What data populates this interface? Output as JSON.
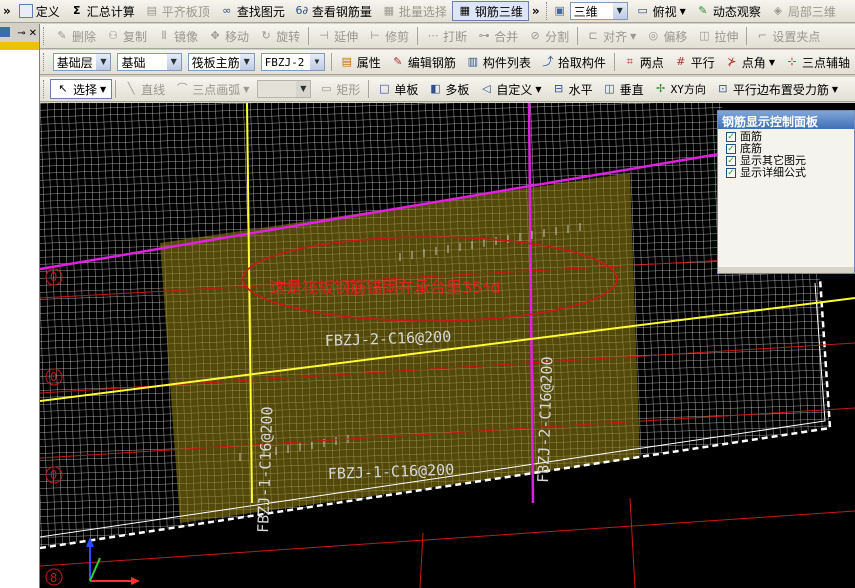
{
  "toolbar1": {
    "items": [
      {
        "label": "定义",
        "icon": "define-icon",
        "disabled": false
      },
      {
        "label": "汇总计算",
        "icon": "sigma-icon",
        "disabled": false
      },
      {
        "label": "平齐板顶",
        "icon": "level-icon",
        "disabled": true
      },
      {
        "label": "查找图元",
        "icon": "binoculars-icon",
        "disabled": false
      },
      {
        "label": "查看钢筋量",
        "icon": "rebar-icon",
        "disabled": false
      },
      {
        "label": "批量选择",
        "icon": "batch-select-icon",
        "disabled": true
      },
      {
        "label": "钢筋三维",
        "icon": "grid-3d-icon",
        "disabled": false,
        "active": true
      }
    ],
    "view_mode": "三维",
    "view_items": [
      {
        "label": "俯视",
        "icon": "top-view-icon",
        "disabled": false
      },
      {
        "label": "动态观察",
        "icon": "orbit-icon",
        "disabled": false
      },
      {
        "label": "局部三维",
        "icon": "local-3d-icon",
        "disabled": true
      }
    ]
  },
  "toolbar2": {
    "items": [
      {
        "label": "删除",
        "icon": "delete-icon"
      },
      {
        "label": "复制",
        "icon": "copy-icon"
      },
      {
        "label": "镜像",
        "icon": "mirror-icon"
      },
      {
        "label": "移动",
        "icon": "move-icon"
      },
      {
        "label": "旋转",
        "icon": "rotate-icon"
      },
      {
        "label": "延伸",
        "icon": "extend-icon"
      },
      {
        "label": "修剪",
        "icon": "trim-icon"
      },
      {
        "label": "打断",
        "icon": "break-icon"
      },
      {
        "label": "合并",
        "icon": "merge-icon"
      },
      {
        "label": "分割",
        "icon": "split-icon"
      },
      {
        "label": "对齐",
        "icon": "align-icon"
      },
      {
        "label": "偏移",
        "icon": "offset-icon"
      },
      {
        "label": "拉伸",
        "icon": "stretch-icon"
      },
      {
        "label": "设置夹点",
        "icon": "grip-point-icon"
      }
    ]
  },
  "toolbar3": {
    "floor": "基础层",
    "type": "基础",
    "component": "筏板主筋",
    "code": "FBZJ-2",
    "buttons": [
      {
        "label": "属性",
        "icon": "properties-icon"
      },
      {
        "label": "编辑钢筋",
        "icon": "edit-rebar-icon"
      },
      {
        "label": "构件列表",
        "icon": "list-icon"
      },
      {
        "label": "拾取构件",
        "icon": "pick-icon"
      },
      {
        "label": "两点",
        "icon": "two-point-icon"
      },
      {
        "label": "平行",
        "icon": "parallel-icon"
      },
      {
        "label": "点角",
        "icon": "point-angle-icon"
      },
      {
        "label": "三点辅轴",
        "icon": "three-point-axis-icon"
      }
    ]
  },
  "toolbar4": {
    "select_label": "选择",
    "disabled_items": [
      {
        "label": "直线",
        "icon": "line-icon"
      },
      {
        "label": "三点画弧",
        "icon": "arc-icon"
      },
      {
        "label": "矩形",
        "icon": "rect-icon"
      }
    ],
    "items": [
      {
        "label": "单板",
        "icon": "single-slab-icon"
      },
      {
        "label": "多板",
        "icon": "multi-slab-icon"
      },
      {
        "label": "自定义",
        "icon": "custom-icon"
      },
      {
        "label": "水平",
        "icon": "horizontal-icon"
      },
      {
        "label": "垂直",
        "icon": "vertical-icon"
      },
      {
        "label": "XY方向",
        "icon": "xy-direction-icon"
      },
      {
        "label": "平行边布置受力筋",
        "icon": "parallel-edge-icon"
      }
    ]
  },
  "left_panel": {
    "pin": "⊸",
    "close": "✕"
  },
  "viewport": {
    "annotation": "这是筏板钢筋锚固在承台里35*d",
    "labels": {
      "top_horizontal": "FBZJ-2-C16@200",
      "bottom_horizontal": "FBZJ-1-C16@200",
      "left_vertical": "FBZJ-1-C16@200",
      "right_vertical": "FBZJ-2-C16@200"
    },
    "axis_marks": [
      "0",
      "0",
      "0",
      "0",
      "8"
    ],
    "colors": {
      "background": "#000000",
      "mesh": "#d8d8d8",
      "slab_fill": "#8a7a10",
      "magenta_line": "#e020e0",
      "yellow_line": "#ffff33",
      "red_line": "#c81818",
      "annotation": "#e02020"
    }
  },
  "rebar_panel": {
    "title": "钢筋显示控制面板",
    "options": [
      {
        "label": "面筋",
        "checked": true
      },
      {
        "label": "底筋",
        "checked": true
      },
      {
        "label": "显示其它图元",
        "checked": true
      },
      {
        "label": "显示详细公式",
        "checked": true
      }
    ]
  }
}
